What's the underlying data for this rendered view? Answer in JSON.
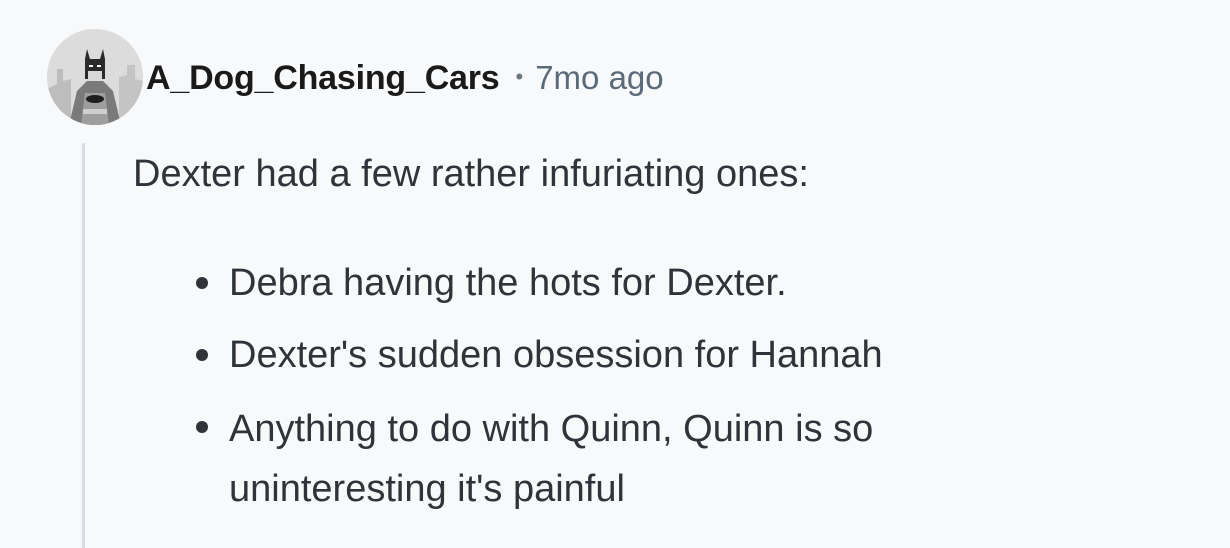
{
  "comment": {
    "username": "A_Dog_Chasing_Cars",
    "separator": "•",
    "timestamp": "7mo ago",
    "avatar_icon": "batman-avatar-icon",
    "body": "Dexter had a few rather infuriating ones:",
    "bullets": [
      "Debra having the hots for Dexter.",
      "Dexter's sudden obsession for Hannah",
      "Anything to do with Quinn, Quinn is so uninteresting it's painful"
    ]
  },
  "colors": {
    "background": "#f8f9fb",
    "text": "#2f343a",
    "username": "#1a1a1b",
    "timestamp": "#5b6a7a",
    "thread_line": "#d6dde5"
  }
}
